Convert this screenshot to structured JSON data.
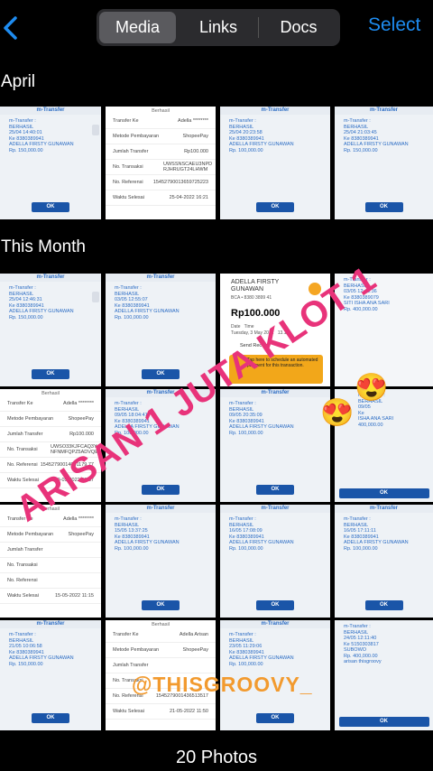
{
  "header": {
    "tabs": [
      {
        "label": "Media",
        "active": true
      },
      {
        "label": "Links",
        "active": false
      },
      {
        "label": "Docs",
        "active": false
      }
    ],
    "select_label": "Select",
    "accent_color": "#1e8cf0"
  },
  "sections": [
    {
      "title": "April"
    },
    {
      "title": "This Month"
    }
  ],
  "thumbs": {
    "mtransfer_title": "m-Transfer",
    "ok_label": "OK",
    "april_1": "m-Transfer :\nBERHASIL\n25/04 14:40:01\nKe 8380389941\nADELLA FIRSTY GUNAWAN\nRp. 150,000.00",
    "april_3": "m-Transfer :\nBERHASIL\n25/04 20:23:58\nKe 8380389941\nADELLA FIRSTY GUNAWAN\nRp. 100,000.00",
    "april_4": "m-Transfer :\nBERHASIL\n25/04 21:03:45\nKe 8380389941\nADELLA FIRSTY GUNAWAN\nRp. 150,000.00",
    "paper1": {
      "title": "Berhasil",
      "rows": [
        [
          "Transfer Ke",
          "Adella ********"
        ],
        [
          "Metode Pembayaran",
          "ShopeePay"
        ],
        [
          "Jumlah Transfer",
          "Rp100.000"
        ],
        [
          "No. Transaksi",
          "UWSSNSCAEU3NPD RJHRUGT24LHWM"
        ],
        [
          "No. Referensi",
          "15452790013659725223"
        ],
        [
          "Waktu Selesai",
          "25-04-2022 16:21"
        ]
      ]
    },
    "m1": "m-Transfer :\nBERHASIL\n25/04 12:46:31\nKe 8380389941\nADELLA FIRSTY GUNAWAN\nRp. 150,000.00",
    "m2": "m-Transfer :\nBERHASIL\n03/05 12:55:07\nKe 8380389941\nADELLA FIRSTY GUNAWAN\nRp. 100,000.00",
    "gopay": {
      "name": "ADELLA FIRSTY\nGUNAWAN",
      "bank": "BCA • 8380 3899 41",
      "amount": "Rp100.000",
      "date_label": "Date",
      "date": "Tuesday, 3 May 2022",
      "time_label": "Time",
      "time": "13.17",
      "receipt": "Send Receipt",
      "promo": "Tap here to schedule an automated payment for this transaction."
    },
    "m4": "m-Transfer :\nBERHASIL\n03/05 12:46:36\nKe 8380389079\nSITI ISHA ANA SARI\nRp. 400,000.00",
    "paper2": {
      "title": "Berhasil",
      "rows": [
        [
          "Transfer Ke",
          "Adella ********"
        ],
        [
          "Metode Pembayaran",
          "ShopeePay"
        ],
        [
          "Jumlah Transfer",
          "Rp100.000"
        ],
        [
          "No. Transaksi",
          "UWSO33KJFCAQ3Y4 NFNMFQPZ5ADVQE"
        ],
        [
          "No. Referensi",
          "15452790014041179 77"
        ],
        [
          "Waktu Selesai",
          "09-05-2022 09:57"
        ]
      ]
    },
    "m6": "m-Transfer :\nBERHASIL\n09/05 18:04:41\nKe 8380389941\nADELLA FIRSTY GUNAWAN\nRp. 100,000.00",
    "m7": "m-Transfer :\nBERHASIL\n09/05 20:35:09\nKe 8380389941\nADELLA FIRSTY GUNAWAN\nRp. 100,000.00",
    "m8": "m-Transfer :\nBERHASIL\n09/05\nKe\nISHA ANA SARI\n400,000.00",
    "paper3": {
      "title": "Berhasil",
      "rows": [
        [
          "Transfer Ke",
          "Adella ********"
        ],
        [
          "Metode Pembayaran",
          "ShopeePay"
        ],
        [
          "Jumlah Transfer",
          ""
        ],
        [
          "No. Transaksi",
          ""
        ],
        [
          "No. Referensi",
          ""
        ],
        [
          "Waktu Selesai",
          "15-05-2022 11:15"
        ]
      ]
    },
    "m10": "m-Transfer :\nBERHASIL\n15/05 13:37:25\nKe 8380389941\nADELLA FIRSTY GUNAWAN\nRp. 100,000.00",
    "m11": "m-Transfer :\nBERHASIL\n16/05 17:08:09\nKe 8380389941\nADELLA FIRSTY GUNAWAN\nRp. 100,000.00",
    "m12": "m-Transfer :\nBERHASIL\n16/05 17:11:11\nKe 8380389941\nADELLA FIRSTY GUNAWAN\nRp. 100,000.00",
    "m13": "m-Transfer :\nBERHASIL\n21/05 10:06:58\nKe 8380389941\nADELLA FIRSTY GUNAWAN\nRp. 150,000.00",
    "paper4": {
      "title": "Berhasil",
      "rows": [
        [
          "Transfer Ke",
          "Adella Arisan"
        ],
        [
          "Metode Pembayaran",
          "ShopeePay"
        ],
        [
          "Jumlah Transfer",
          ""
        ],
        [
          "No. Transaksi",
          ""
        ],
        [
          "No. Referensi",
          "1545279001436513517"
        ],
        [
          "Waktu Selesai",
          "21-05-2022 11:50"
        ]
      ]
    },
    "m15": "m-Transfer :\nBERHASIL\n23/05 11:29:06\nKe 8380389941\nADELLA FIRSTY GUNAWAN\nRp. 100,000.00",
    "m16": "m-Transfer :\nBERHASIL\n24/05 12:11:40\nKe 5150303817\nSUBOWO\nRp. 400,000.00\narisan thisgroovy"
  },
  "overlay": {
    "arisan_text": "ARISAN 1 JUTA KLOT 1",
    "tag_text": "@THISGROOVY_",
    "emoji": "😍"
  },
  "footer": {
    "count_label": "20 Photos"
  }
}
